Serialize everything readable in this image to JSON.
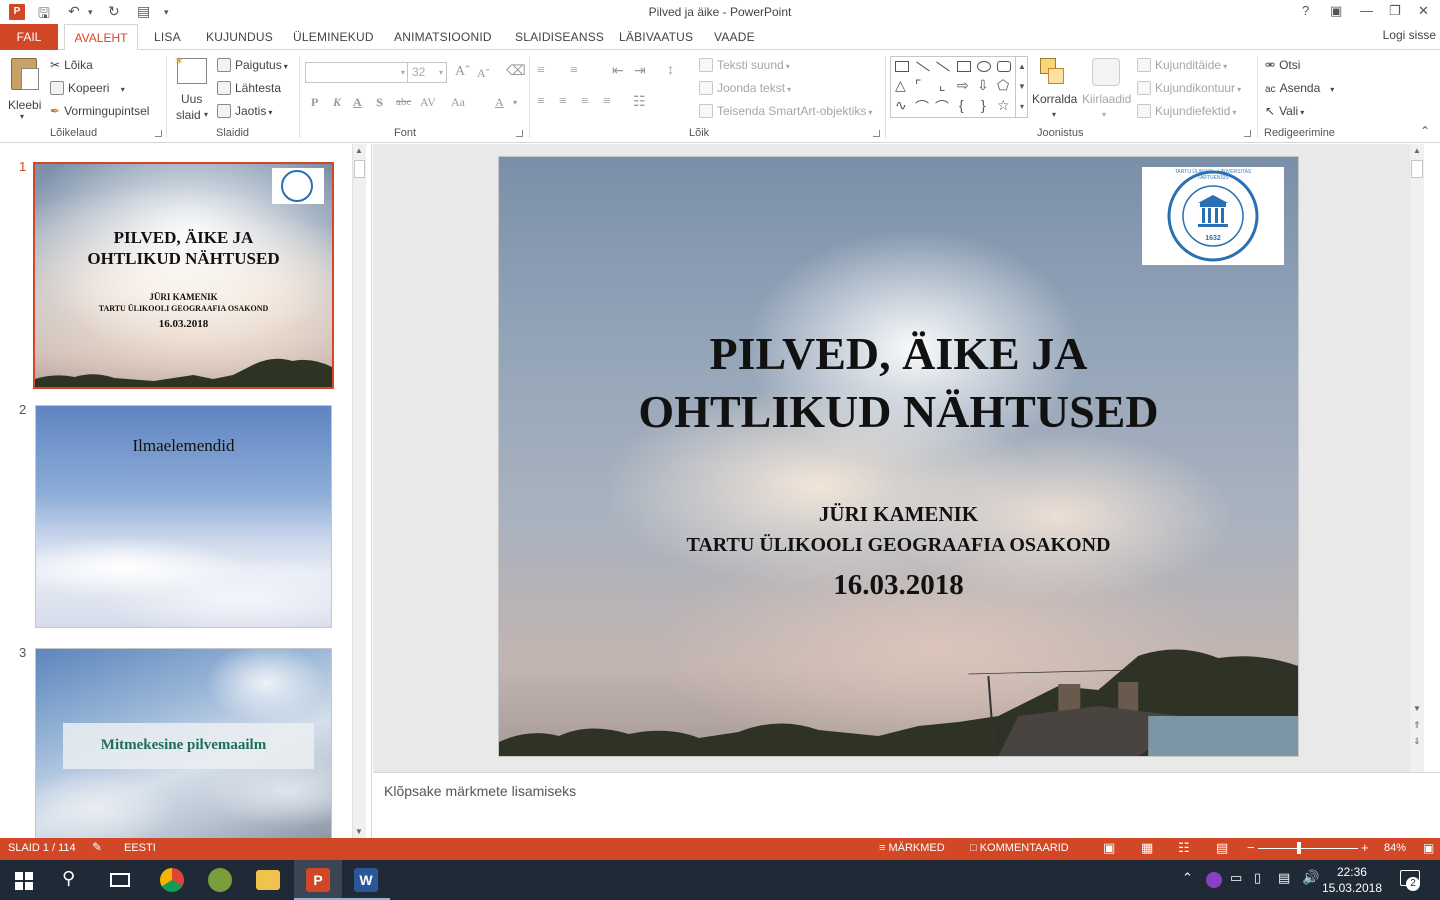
{
  "app": {
    "window_title": "Pilved ja äike - PowerPoint",
    "login": "Logi sisse",
    "help": "?"
  },
  "tabs": [
    {
      "label": "FAIL"
    },
    {
      "label": "AVALEHT"
    },
    {
      "label": "LISA"
    },
    {
      "label": "KUJUNDUS"
    },
    {
      "label": "ÜLEMINEKUD"
    },
    {
      "label": "ANIMATSIOONID"
    },
    {
      "label": "SLAIDISEANSS"
    },
    {
      "label": "LÄBIVAATUS"
    },
    {
      "label": "VAADE"
    }
  ],
  "ribbon": {
    "clipboard": {
      "paste": "Kleebi",
      "cut": "Lõika",
      "copy": "Kopeeri",
      "format_painter": "Vormingupintsel",
      "label": "Lõikelaud"
    },
    "slides": {
      "new_slide_line1": "Uus",
      "new_slide_line2": "slaid",
      "layout": "Paigutus",
      "reset": "Lähtesta",
      "section": "Jaotis",
      "label": "Slaidid"
    },
    "font": {
      "font_name": "",
      "font_size": "32",
      "bold": "P",
      "italic": "K",
      "underline": "A",
      "shadow": "S",
      "strike": "abc",
      "spacing": "AV",
      "case": "Aa",
      "color": "A",
      "label": "Font"
    },
    "paragraph": {
      "text_direction": "Teksti suund",
      "align_text": "Joonda tekst",
      "smartart": "Teisenda SmartArt-objektiks",
      "label": "Lõik"
    },
    "drawing": {
      "arrange": "Korralda",
      "quick_styles": "Kiirlaadid",
      "shape_fill": "Kujunditäide",
      "shape_outline": "Kujundikontuur",
      "shape_effects": "Kujundiefektid",
      "label": "Joonistus"
    },
    "editing": {
      "find": "Otsi",
      "replace": "Asenda",
      "select": "Vali",
      "label": "Redigeerimine"
    }
  },
  "thumbnails": [
    {
      "number": "1",
      "title_line1": "PILVED, ÄIKE JA",
      "title_line2": "OHTLIKUD NÄHTUSED",
      "author": "JÜRI KAMENIK",
      "org": "TARTU ÜLIKOOLI GEOGRAAFIA OSAKOND",
      "date": "16.03.2018"
    },
    {
      "number": "2",
      "title": "Ilmaelemendid"
    },
    {
      "number": "3",
      "title": "Mitmekesine pilvemaailm"
    }
  ],
  "slide": {
    "title_line1": "PILVED, ÄIKE JA",
    "title_line2": "OHTLIKUD NÄHTUSED",
    "author": "JÜRI KAMENIK",
    "org": "TARTU ÜLIKOOLI GEOGRAAFIA OSAKOND",
    "date": "16.03.2018",
    "logo_text": "TARTU ÜLIKOOL · UNIVERSITAS TARTUENSIS",
    "logo_year": "1632"
  },
  "notes": {
    "placeholder": "Klõpsake märkmete lisamiseks"
  },
  "status": {
    "slide_counter": "SLAID 1 / 114",
    "language": "EESTI",
    "notes": "MÄRKMED",
    "comments": "KOMMENTAARID",
    "zoom": "84%",
    "zoom_percent": 84
  },
  "taskbar": {
    "time": "22:36",
    "date": "15.03.2018",
    "notification_count": "2"
  },
  "colors": {
    "accent": "#d24726",
    "taskbar": "#1f2a36",
    "slide3_title": "#1e6e5a"
  }
}
